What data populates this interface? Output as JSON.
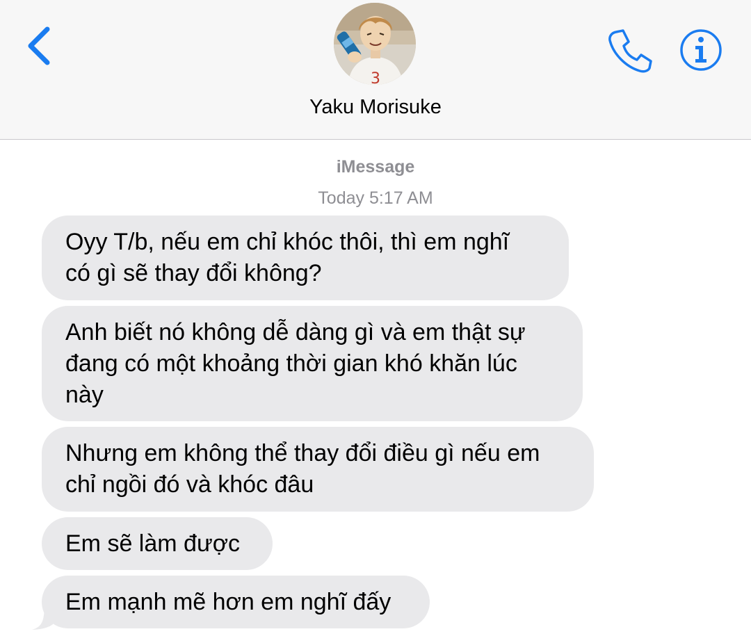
{
  "header": {
    "contact_name": "Yaku Morisuke",
    "back_icon": "chevron-left-icon",
    "phone_icon": "phone-icon",
    "info_icon": "info-icon",
    "accent_color": "#1a7cf0",
    "avatar": "contact-avatar"
  },
  "conversation": {
    "service": "iMessage",
    "timestamp": "Today 5:17 AM",
    "bubble_color": "#e9e9eb",
    "messages": [
      {
        "lines": [
          "Oyy T/b, nếu em chỉ khóc thôi, thì em nghĩ",
          "có gì sẽ thay đổi không?"
        ]
      },
      {
        "lines": [
          "Anh biết nó không dễ dàng gì và em thật sự",
          "đang có một khoảng thời gian khó khăn lúc",
          "này"
        ]
      },
      {
        "lines": [
          "Nhưng em không thể thay đổi điều gì nếu em",
          "chỉ ngồi đó và khóc đâu"
        ]
      },
      {
        "lines": [
          "Em sẽ làm được"
        ]
      },
      {
        "lines": [
          "Em mạnh mẽ hơn em nghĩ đấy"
        ]
      }
    ]
  }
}
